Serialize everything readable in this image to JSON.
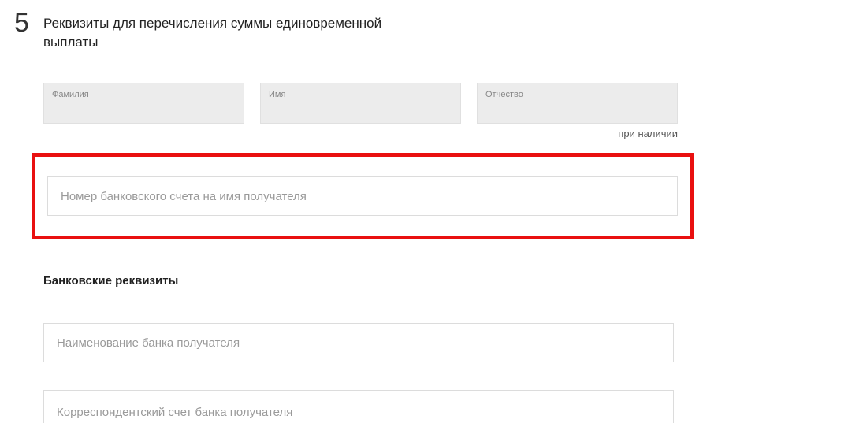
{
  "step": {
    "number": "5",
    "title": "Реквизиты для перечисления суммы единовременной выплаты"
  },
  "name": {
    "surname_label": "Фамилия",
    "firstname_label": "Имя",
    "patronymic_label": "Отчество",
    "patronymic_hint": "при наличии"
  },
  "account": {
    "placeholder": "Номер банковского счета на имя получателя"
  },
  "bank": {
    "heading": "Банковские реквизиты",
    "name_placeholder": "Наименование банка получателя",
    "corr_placeholder": "Корреспондентский счет банка получателя"
  }
}
